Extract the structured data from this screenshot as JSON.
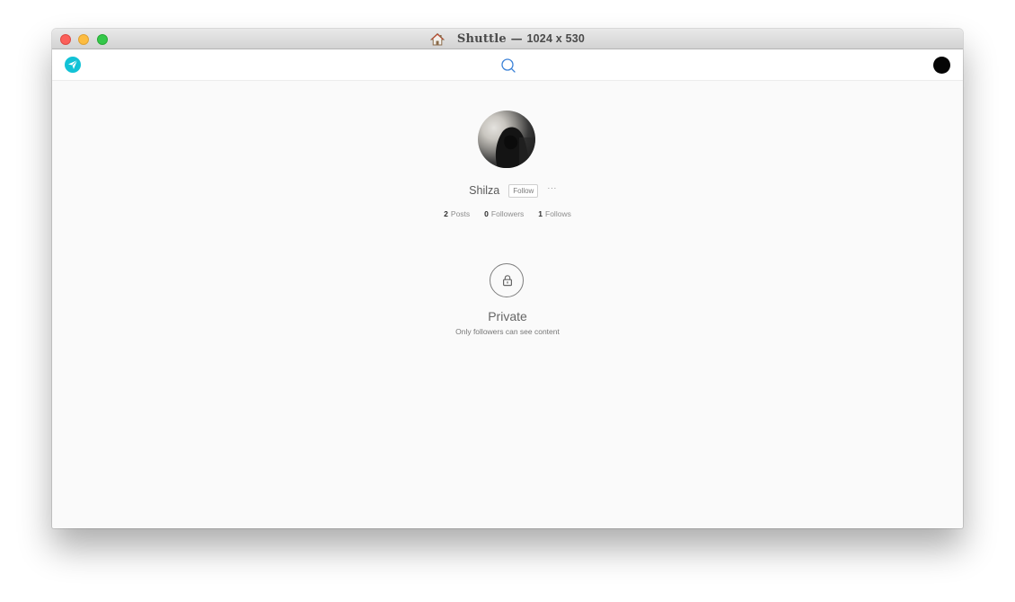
{
  "window": {
    "title_app": "Shuttle",
    "title_separator": " — ",
    "title_dimensions": "1024 x 530"
  },
  "toolbar": {
    "logo_icon": "paper-plane-icon",
    "search_icon": "search-icon",
    "accent_color": "#12c2d6"
  },
  "profile": {
    "username": "Shilza",
    "follow_label": "Follow",
    "more_label": "···",
    "stats": [
      {
        "count": "2",
        "label": "Posts"
      },
      {
        "count": "0",
        "label": "Followers"
      },
      {
        "count": "1",
        "label": "Follows"
      }
    ]
  },
  "privacy": {
    "title": "Private",
    "subtitle": "Only followers can see content"
  }
}
